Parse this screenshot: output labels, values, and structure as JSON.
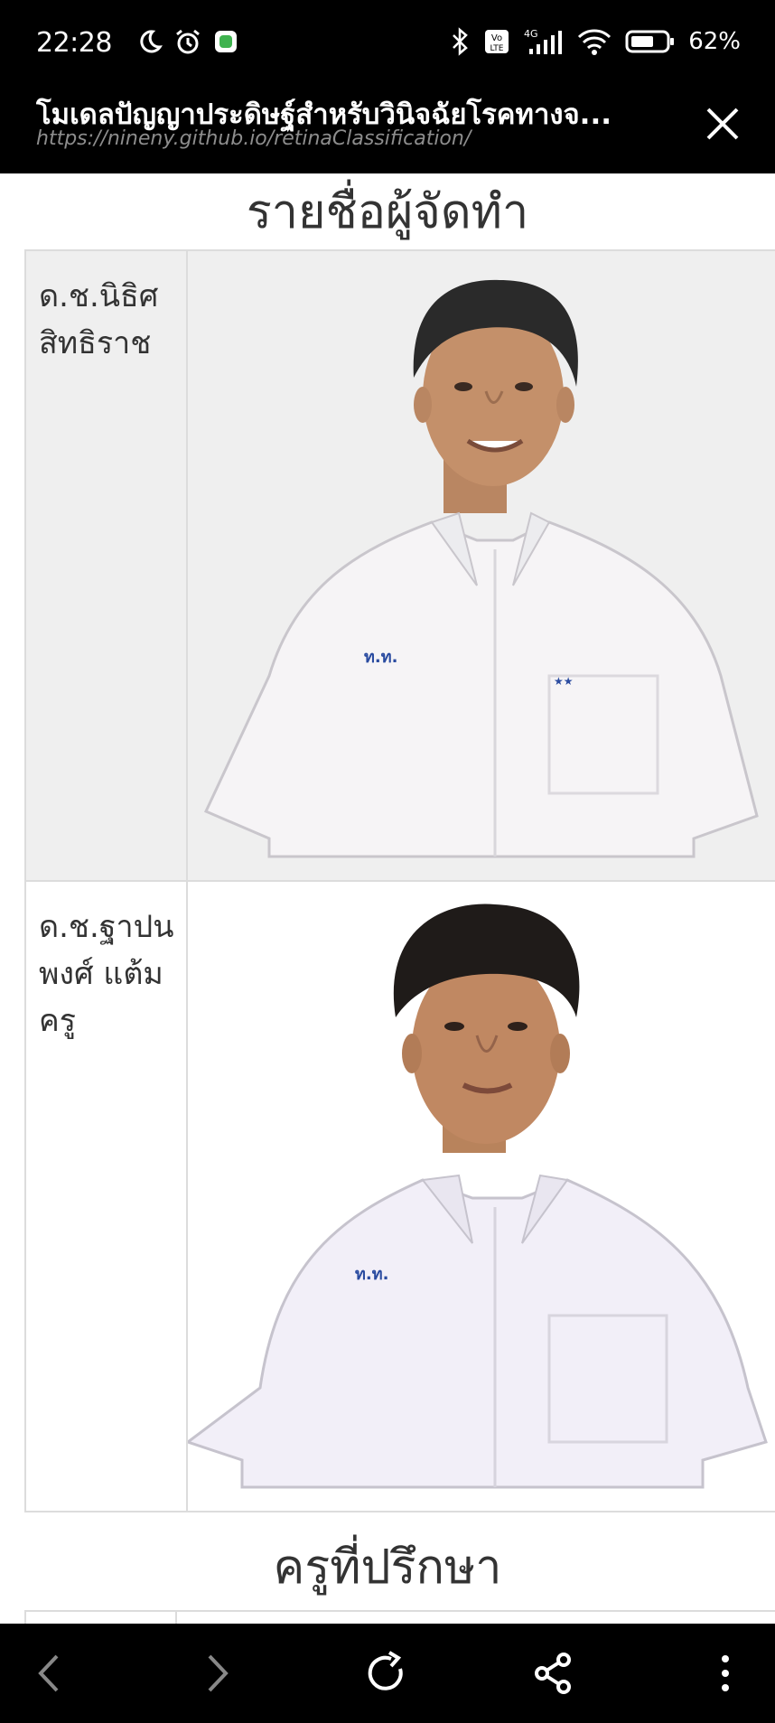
{
  "status_bar": {
    "time": "22:28",
    "battery": "62%",
    "network": "4G",
    "icons": [
      "moon-icon",
      "alarm-icon",
      "app-notification-icon",
      "bluetooth-icon",
      "volte-icon",
      "signal-icon",
      "wifi-icon",
      "battery-icon"
    ]
  },
  "browser": {
    "title": "โมเดลปัญญาประดิษฐ์สำหรับวินิจฉัยโรคทางจ...",
    "url": "https://nineny.github.io/retinaClassification/",
    "close_icon": "close-icon"
  },
  "section_members": {
    "heading": "รายชื่อผู้จัดทำ",
    "members": [
      {
        "name_line1": "ด.ช.นิธิศ",
        "name_line2": "สิทธิราช",
        "name_line3": ""
      },
      {
        "name_line1": "ด.ช.ฐาปน",
        "name_line2": "พงศ์ แต้ม",
        "name_line3": "ครู"
      }
    ]
  },
  "section_advisors": {
    "heading": "ครูที่ปรึกษา"
  },
  "bottom_nav": {
    "icons": [
      "back-icon",
      "forward-icon",
      "reload-icon",
      "share-icon",
      "more-icon"
    ]
  },
  "colors": {
    "bar": "#000000",
    "url_gray": "#8d8d8d",
    "row_alt": "#efefef",
    "border": "#dcdcdc",
    "shirt": "#f4f2f6"
  }
}
